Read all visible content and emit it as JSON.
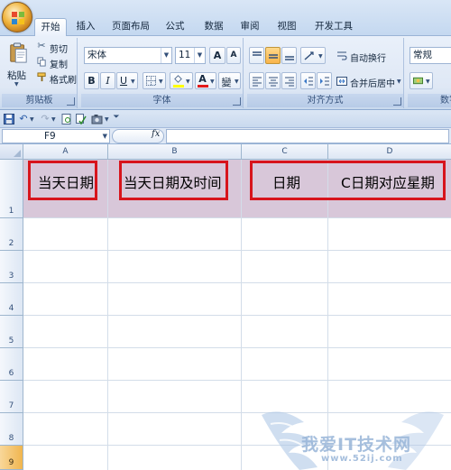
{
  "ribbon_tabs": [
    "开始",
    "插入",
    "页面布局",
    "公式",
    "数据",
    "审阅",
    "视图",
    "开发工具"
  ],
  "clipboard": {
    "paste_label": "粘贴",
    "cut_label": "剪切",
    "copy_label": "复制",
    "format_painter_label": "格式刷",
    "group_label": "剪贴板"
  },
  "font": {
    "font_name": "宋体",
    "font_size": "11",
    "bold": "B",
    "italic": "I",
    "underline": "U",
    "grow": "A",
    "shrink": "A",
    "font_color": "A",
    "phonetic": "變",
    "group_label": "字体"
  },
  "alignment": {
    "wrap_text_label": "自动换行",
    "merge_center_label": "合并后居中",
    "group_label": "对齐方式"
  },
  "number": {
    "format": "常规",
    "group_label": "数字"
  },
  "formula_bar": {
    "name_box": "F9",
    "fx": "fx"
  },
  "columns": [
    "A",
    "B",
    "C",
    "D"
  ],
  "rows": [
    "1",
    "2",
    "3",
    "4",
    "5",
    "6",
    "7",
    "8",
    "9"
  ],
  "cells": {
    "A1": "当天日期",
    "B1": "当天日期及时间",
    "C1": "日期",
    "D1": "C日期对应星期"
  },
  "watermark": {
    "text": "我爱IT技术网",
    "url": "www.52ij.com"
  },
  "colors": {
    "row1_fill": "#d8c7d9",
    "highlight_box": "#d7141c",
    "selected_row_header": "#f0b54e"
  }
}
